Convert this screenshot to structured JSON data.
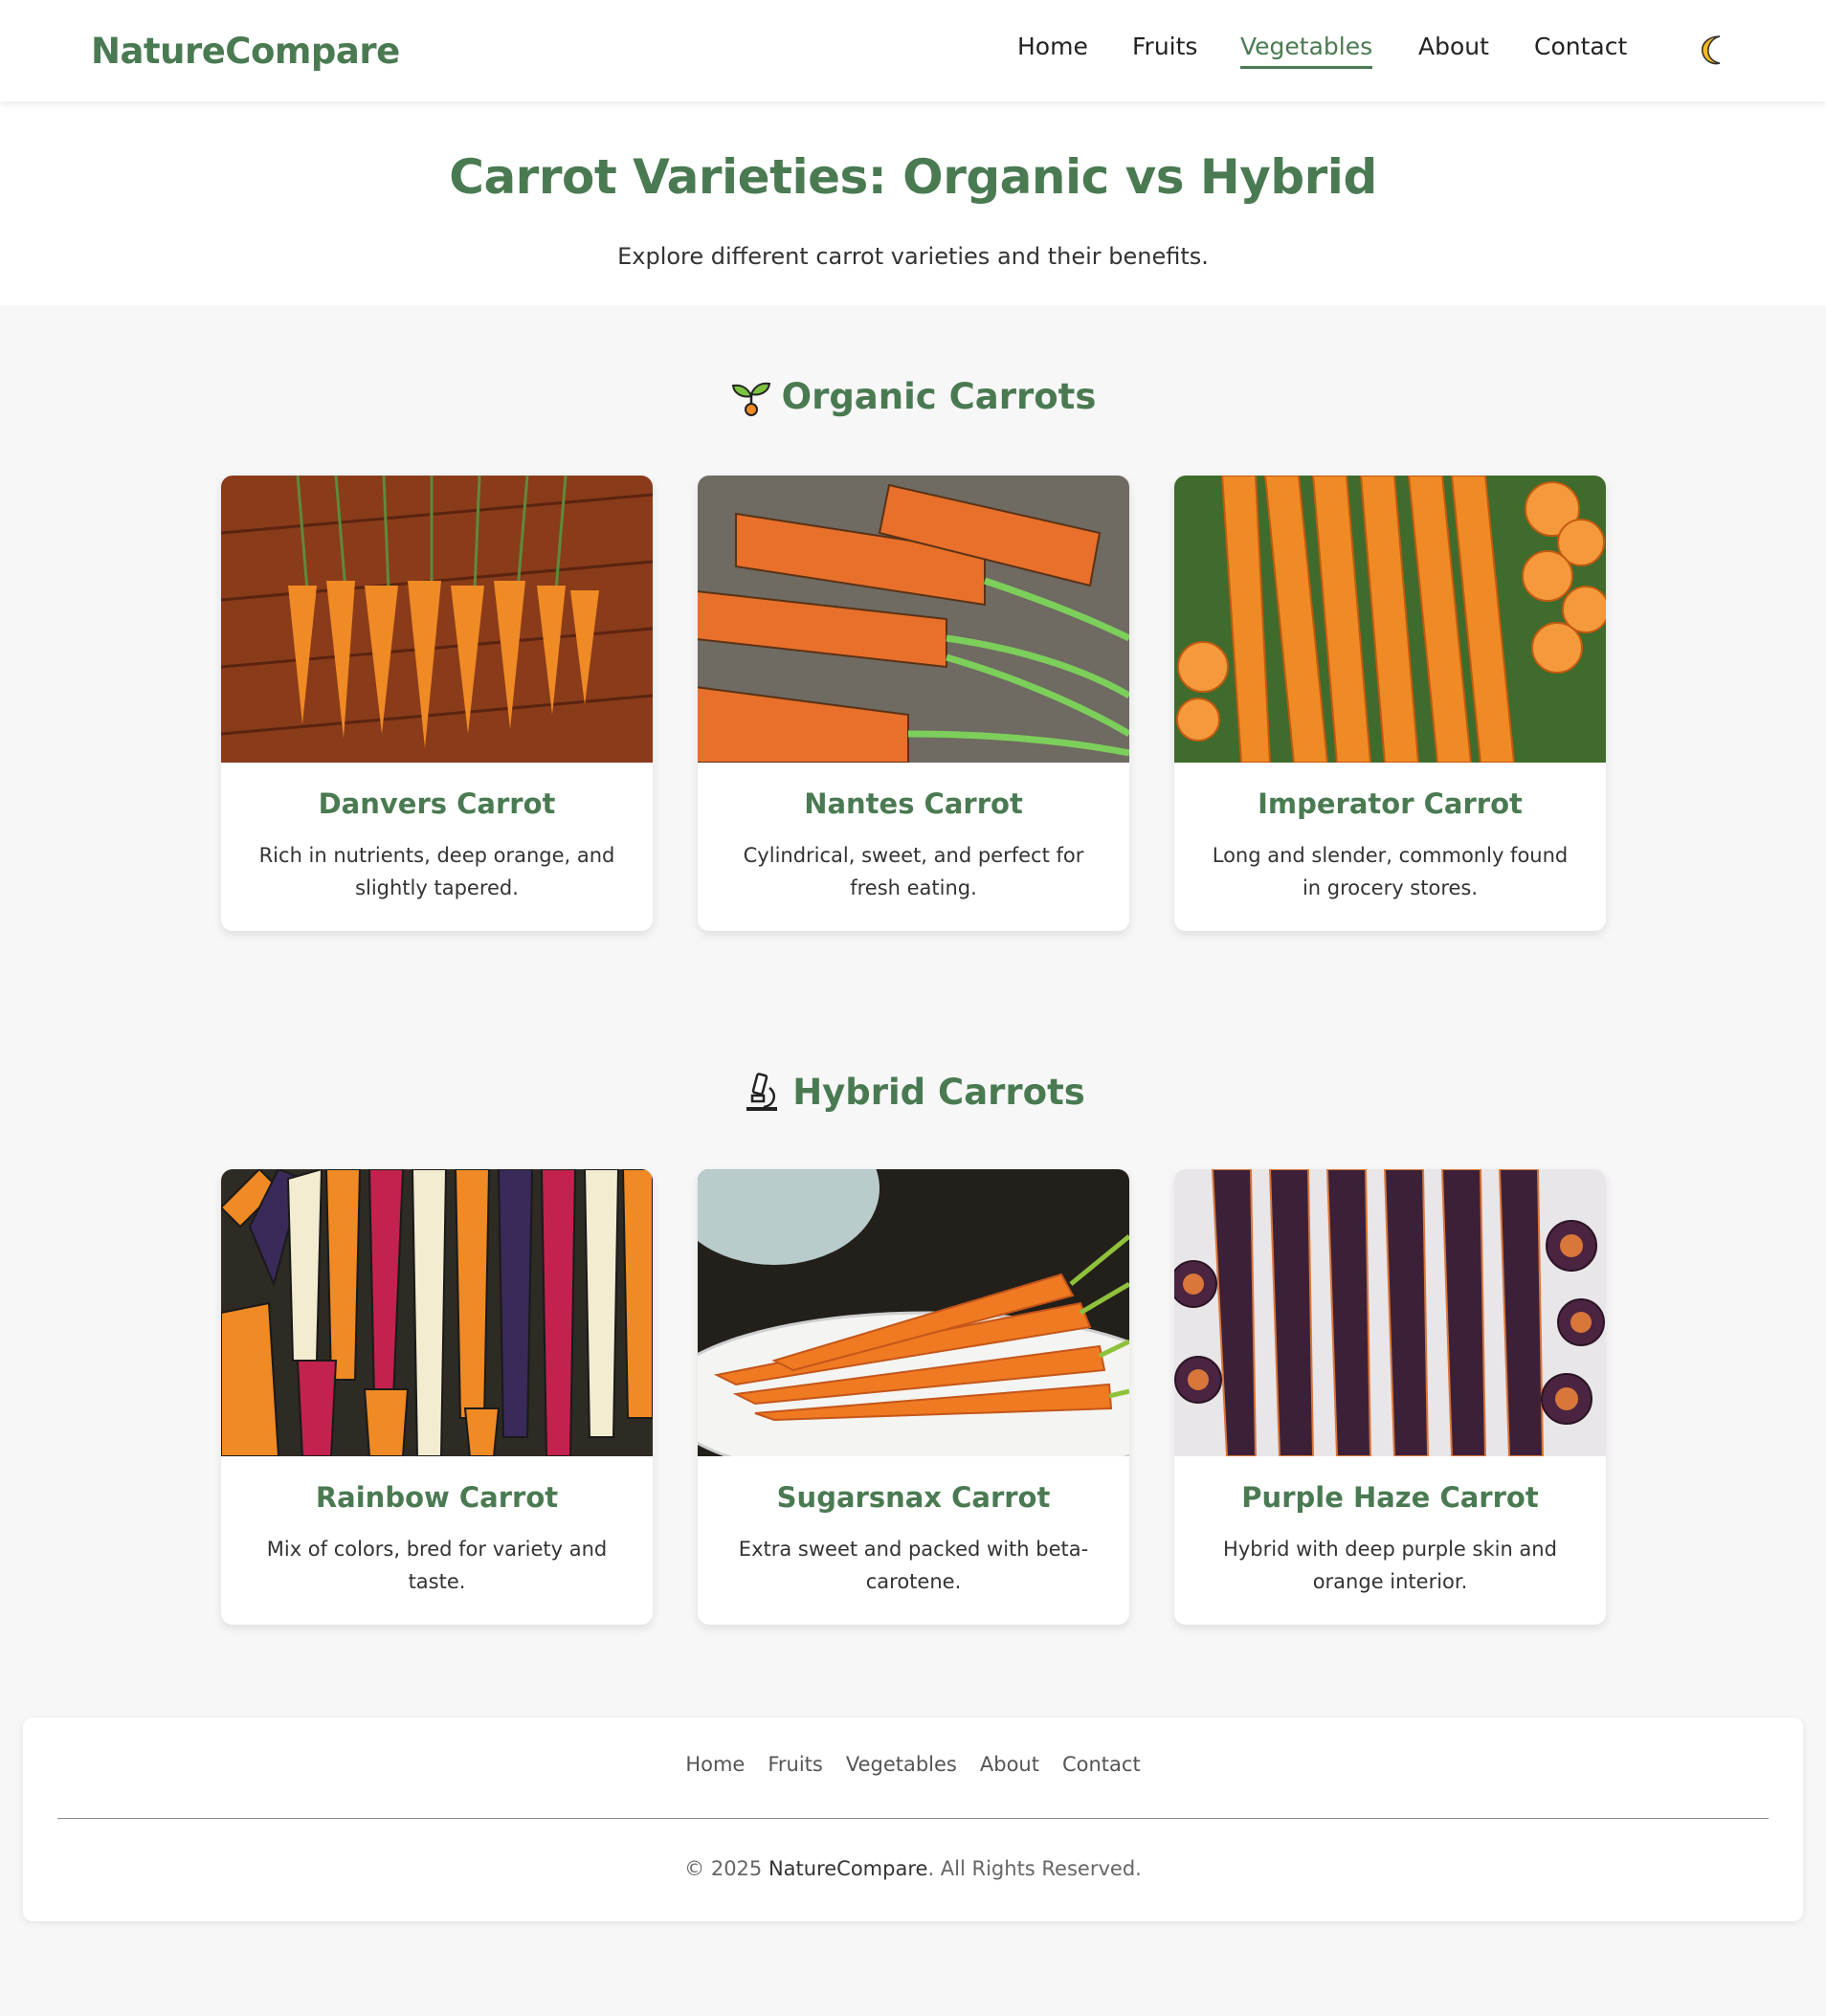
{
  "header": {
    "logo": "NatureCompare",
    "nav": [
      {
        "label": "Home"
      },
      {
        "label": "Fruits"
      },
      {
        "label": "Vegetables",
        "active": true
      },
      {
        "label": "About"
      },
      {
        "label": "Contact"
      }
    ],
    "theme_toggle_icon": "crescent-moon-icon"
  },
  "hero": {
    "title": "Carrot Varieties: Organic vs Hybrid",
    "subtitle": "Explore different carrot varieties and their benefits."
  },
  "sections": [
    {
      "title": "Organic Carrots",
      "icon": "seedling-icon",
      "cards": [
        {
          "title": "Danvers Carrot",
          "description": "Rich in nutrients, deep orange, and slightly tapered."
        },
        {
          "title": "Nantes Carrot",
          "description": "Cylindrical, sweet, and perfect for fresh eating."
        },
        {
          "title": "Imperator Carrot",
          "description": "Long and slender, commonly found in grocery stores."
        }
      ]
    },
    {
      "title": "Hybrid Carrots",
      "icon": "microscope-icon",
      "cards": [
        {
          "title": "Rainbow Carrot",
          "description": "Mix of colors, bred for variety and taste."
        },
        {
          "title": "Sugarsnax Carrot",
          "description": "Extra sweet and packed with beta-carotene."
        },
        {
          "title": "Purple Haze Carrot",
          "description": "Hybrid with deep purple skin and orange interior."
        }
      ]
    }
  ],
  "footer": {
    "links": [
      "Home",
      "Fruits",
      "Vegetables",
      "About",
      "Contact"
    ],
    "copyright_prefix": "© 2025 ",
    "brand": "NatureCompare",
    "copyright_suffix": ". All Rights Reserved."
  },
  "colors": {
    "brand_green": "#4a7a52",
    "page_bg": "#f7f7f7",
    "card_bg": "#ffffff"
  }
}
